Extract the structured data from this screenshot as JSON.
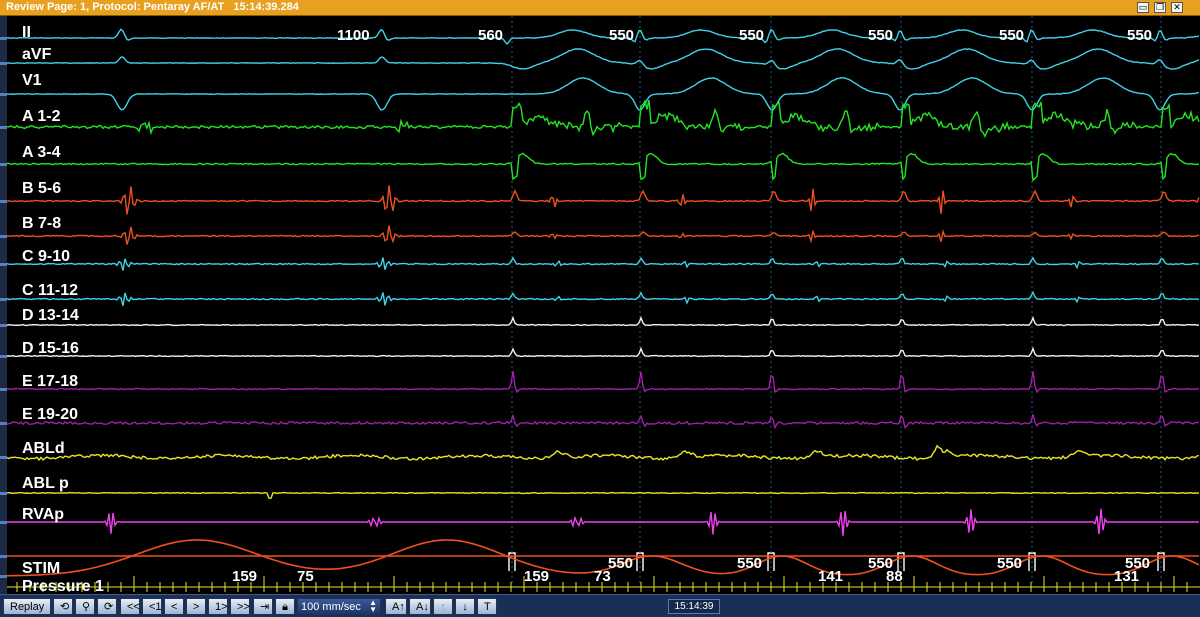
{
  "window": {
    "title": "Review Page: 1, Protocol: Pentaray AF/AT   15:14:39.284",
    "buttons": [
      "minimize",
      "restore",
      "close"
    ]
  },
  "channels": [
    {
      "id": "II",
      "label": "II",
      "color": "#3fd2e8"
    },
    {
      "id": "aVF",
      "label": "aVF",
      "color": "#3fd2e8"
    },
    {
      "id": "V1",
      "label": "V1",
      "color": "#3fd2e8"
    },
    {
      "id": "A12",
      "label": "A 1-2",
      "color": "#22e622"
    },
    {
      "id": "A34",
      "label": "A 3-4",
      "color": "#22e622"
    },
    {
      "id": "B56",
      "label": "B 5-6",
      "color": "#f05020"
    },
    {
      "id": "B78",
      "label": "B 7-8",
      "color": "#f05020"
    },
    {
      "id": "C910",
      "label": "C 9-10",
      "color": "#3fd2e8"
    },
    {
      "id": "C1112",
      "label": "C 11-12",
      "color": "#3fd2e8"
    },
    {
      "id": "D1314",
      "label": "D 13-14",
      "color": "#f2f2f2"
    },
    {
      "id": "D1516",
      "label": "D 15-16",
      "color": "#f2f2f2"
    },
    {
      "id": "E1718",
      "label": "E 17-18",
      "color": "#a020a8"
    },
    {
      "id": "E1920",
      "label": "E 19-20",
      "color": "#a020a8"
    },
    {
      "id": "ABLd",
      "label": "ABLd",
      "color": "#e6e62a"
    },
    {
      "id": "ABLp",
      "label": "ABL p",
      "color": "#e6e62a"
    },
    {
      "id": "RVAp",
      "label": "RVAp",
      "color": "#f040f0"
    },
    {
      "id": "STIM",
      "label": "STIM",
      "color": "#f05020"
    },
    {
      "id": "Pressure1",
      "label": "Pressure 1",
      "color": "#f05020"
    }
  ],
  "cycle_lengths_top": [
    "1100",
    "560",
    "550",
    "550",
    "550",
    "550",
    "550"
  ],
  "cycle_lengths_bottom": [
    "550",
    "550",
    "550",
    "550",
    "550"
  ],
  "bottom_counts": [
    "159",
    "75",
    "159",
    "73",
    "141",
    "88",
    "131"
  ],
  "toolbar": {
    "replay": "Replay",
    "nav": [
      "<<",
      "<1",
      "<",
      ">",
      "1>",
      ">>"
    ],
    "sweep_speed": "100 mm/sec",
    "amp_up": "A↑",
    "amp_down": "A↓",
    "up": "↑",
    "down": "↓",
    "text_btn": "T",
    "clock": "15:14:39"
  },
  "colors": {
    "titlebar": "#e8a020",
    "toolbar": "#1a2f55",
    "background": "#000000"
  }
}
